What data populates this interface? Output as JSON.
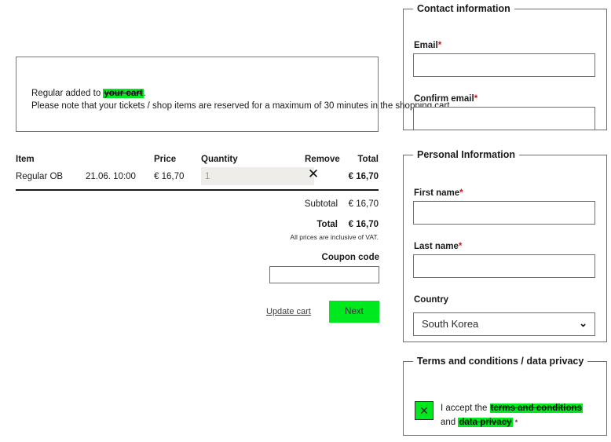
{
  "cart": {
    "notice": {
      "line1_prefix": "Regular added to ",
      "line1_link": "your cart",
      "line1_suffix": ".",
      "line2": "Please note that your tickets / shop items are reserved for a maximum of 30 minutes in the shopping cart."
    },
    "table": {
      "headers": {
        "item": "Item",
        "price": "Price",
        "quantity": "Quantity",
        "remove": "Remove",
        "total": "Total"
      },
      "rows": [
        {
          "item": "Regular OB",
          "date": "21.06. 10:00",
          "price": "€ 16,70",
          "quantity": "1",
          "remove_icon": "✕",
          "total": "€ 16,70"
        }
      ]
    },
    "summary": {
      "subtotal_label": "Subtotal",
      "subtotal_value": "€ 16,70",
      "total_label": "Total",
      "total_value": "€ 16,70",
      "vat_note": "All prices are inclusive of VAT."
    },
    "coupon": {
      "label": "Coupon code",
      "value": "",
      "placeholder": ""
    },
    "actions": {
      "update_cart": "Update cart",
      "next": "Next"
    }
  },
  "contact": {
    "legend": "Contact information",
    "email_label": "Email",
    "email_value": "",
    "confirm_email_label": "Confirm email",
    "confirm_email_value": "",
    "required_mark": "*"
  },
  "personal": {
    "legend": "Personal Information",
    "first_name_label": "First name",
    "first_name_value": "",
    "last_name_label": "Last name",
    "last_name_value": "",
    "country_label": "Country",
    "country_value": "South Korea",
    "chevron_icon": "⌄",
    "required_mark": "*"
  },
  "terms": {
    "legend": "Terms and conditions / data privacy",
    "checkbox_checked": true,
    "check_icon": "✕",
    "text_prefix": "I accept the ",
    "link_terms": "terms and conditions",
    "text_middle": " and ",
    "link_privacy": "data privacy",
    "text_suffix": " ",
    "required_mark": "*"
  },
  "colors": {
    "accent_green": "#00e81e",
    "required_red": "#b32020",
    "border_gray": "#6e6e6e",
    "input_fill_gray": "#efede9"
  }
}
